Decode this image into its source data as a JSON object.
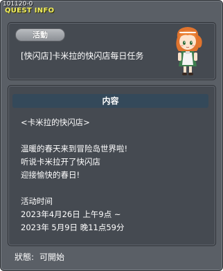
{
  "window": {
    "quest_id": "101120-0",
    "title": "QUEST INFO"
  },
  "quest": {
    "badge": "活動",
    "name": "[快闪店]卡米拉的快闪店每日任务",
    "npc_icon": "npc-girl-orange-hair"
  },
  "content_section": {
    "header": "内容",
    "lines": [
      "<卡米拉的快闪店>",
      "",
      "温暖的春天来到冒险岛世界啦!",
      "听说卡米拉开了快闪店",
      "迎接愉快的春日!",
      "",
      "活动时间",
      "2023年4月26日  上午9点  ~",
      "2023年 5月9日  晚11点59分"
    ]
  },
  "status": {
    "label": "狀態:",
    "value": "可開始"
  }
}
